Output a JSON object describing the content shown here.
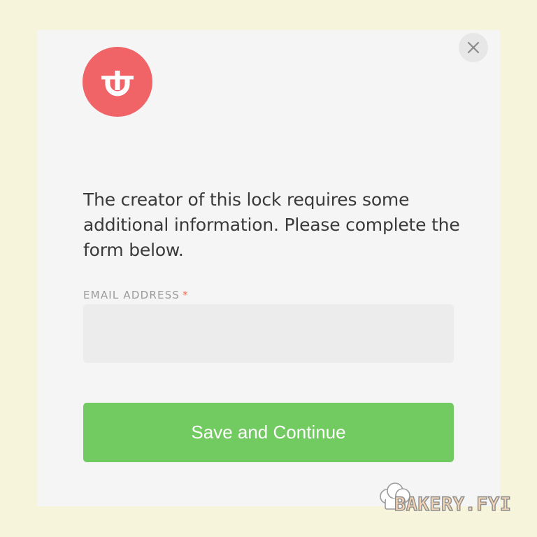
{
  "modal": {
    "close_icon": "close-icon",
    "logo_icon": "unlock-logo-icon",
    "message": "The creator of this lock requires some additional information. Please complete the form below.",
    "email_label": "EMAIL ADDRESS",
    "required_mark": "*",
    "email_value": "",
    "email_placeholder": "",
    "submit_label": "Save and Continue"
  },
  "watermark": {
    "text": "BAKERY.FYI",
    "icon": "chef-hat-icon"
  },
  "colors": {
    "page_background": "#f6f5dc",
    "modal_background": "#f5f5f5",
    "logo_red": "#f06468",
    "button_green": "#72cb61",
    "required_red": "#e96a56"
  }
}
